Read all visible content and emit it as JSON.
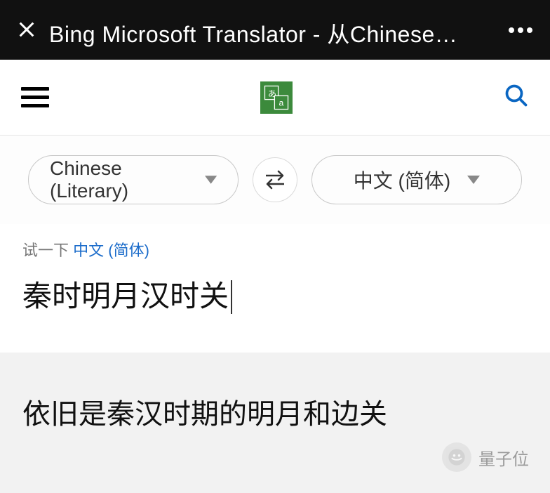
{
  "titleBar": {
    "title": "Bing Microsoft Translator - 从Chinese…"
  },
  "languageSelector": {
    "sourceLanguage": "Chinese (Literary)",
    "targetLanguage": "中文 (简体)"
  },
  "tryPrompt": {
    "label": "试一下 ",
    "link": "中文 (简体)"
  },
  "input": {
    "text": "秦时明月汉时关"
  },
  "output": {
    "text": "依旧是秦汉时期的明月和边关"
  },
  "watermark": {
    "text": "量子位"
  }
}
